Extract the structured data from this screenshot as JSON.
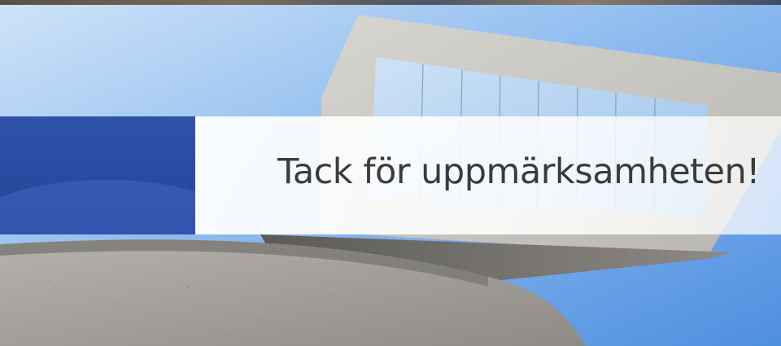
{
  "slide": {
    "title": "Tack för uppmärksamheten!"
  },
  "colors": {
    "accent_band": "#2a4aa0",
    "title_text": "#3b3b3b",
    "sky": "#7fb0ea"
  }
}
